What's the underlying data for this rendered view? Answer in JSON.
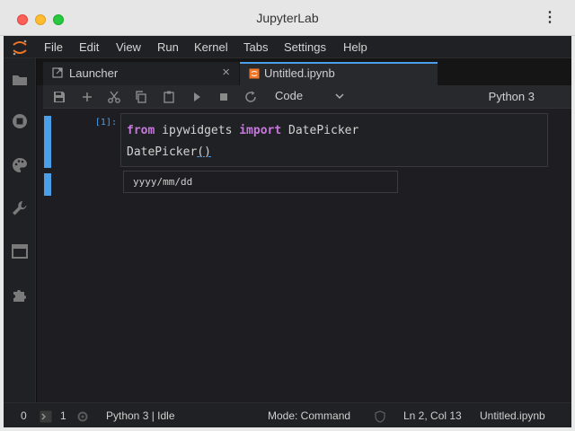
{
  "window": {
    "title": "JupyterLab"
  },
  "menubar": {
    "items": [
      "File",
      "Edit",
      "View",
      "Run",
      "Kernel",
      "Tabs",
      "Settings",
      "Help"
    ]
  },
  "sidebar": {
    "icons": [
      "folder-icon",
      "running-icon",
      "palette-icon",
      "wrench-icon",
      "tabs-icon",
      "extension-icon"
    ]
  },
  "tabs": [
    {
      "label": "Launcher",
      "icon": "launcher-icon",
      "active": false
    },
    {
      "label": "Untitled.ipynb",
      "icon": "notebook-icon",
      "active": true
    }
  ],
  "toolbar": {
    "cell_type": "Code",
    "kernel": "Python 3"
  },
  "cell": {
    "prompt": "[1]:",
    "code": {
      "line1": {
        "kw1": "from",
        "mod": " ipywidgets ",
        "kw2": "import",
        "name": " DatePicker"
      },
      "line2": {
        "call": "DatePicker",
        "parens": "()"
      }
    }
  },
  "output": {
    "date_placeholder": "yyyy/mm/dd"
  },
  "statusbar": {
    "terminals": "0",
    "kernels": "1",
    "kernel_status": "Python 3 | Idle",
    "mode": "Mode: Command",
    "cursor": "Ln 2, Col 13",
    "file": "Untitled.ipynb"
  },
  "colors": {
    "accent": "#4a9fe8",
    "keyword": "#c778dd",
    "jupyter_orange": "#f37626"
  }
}
